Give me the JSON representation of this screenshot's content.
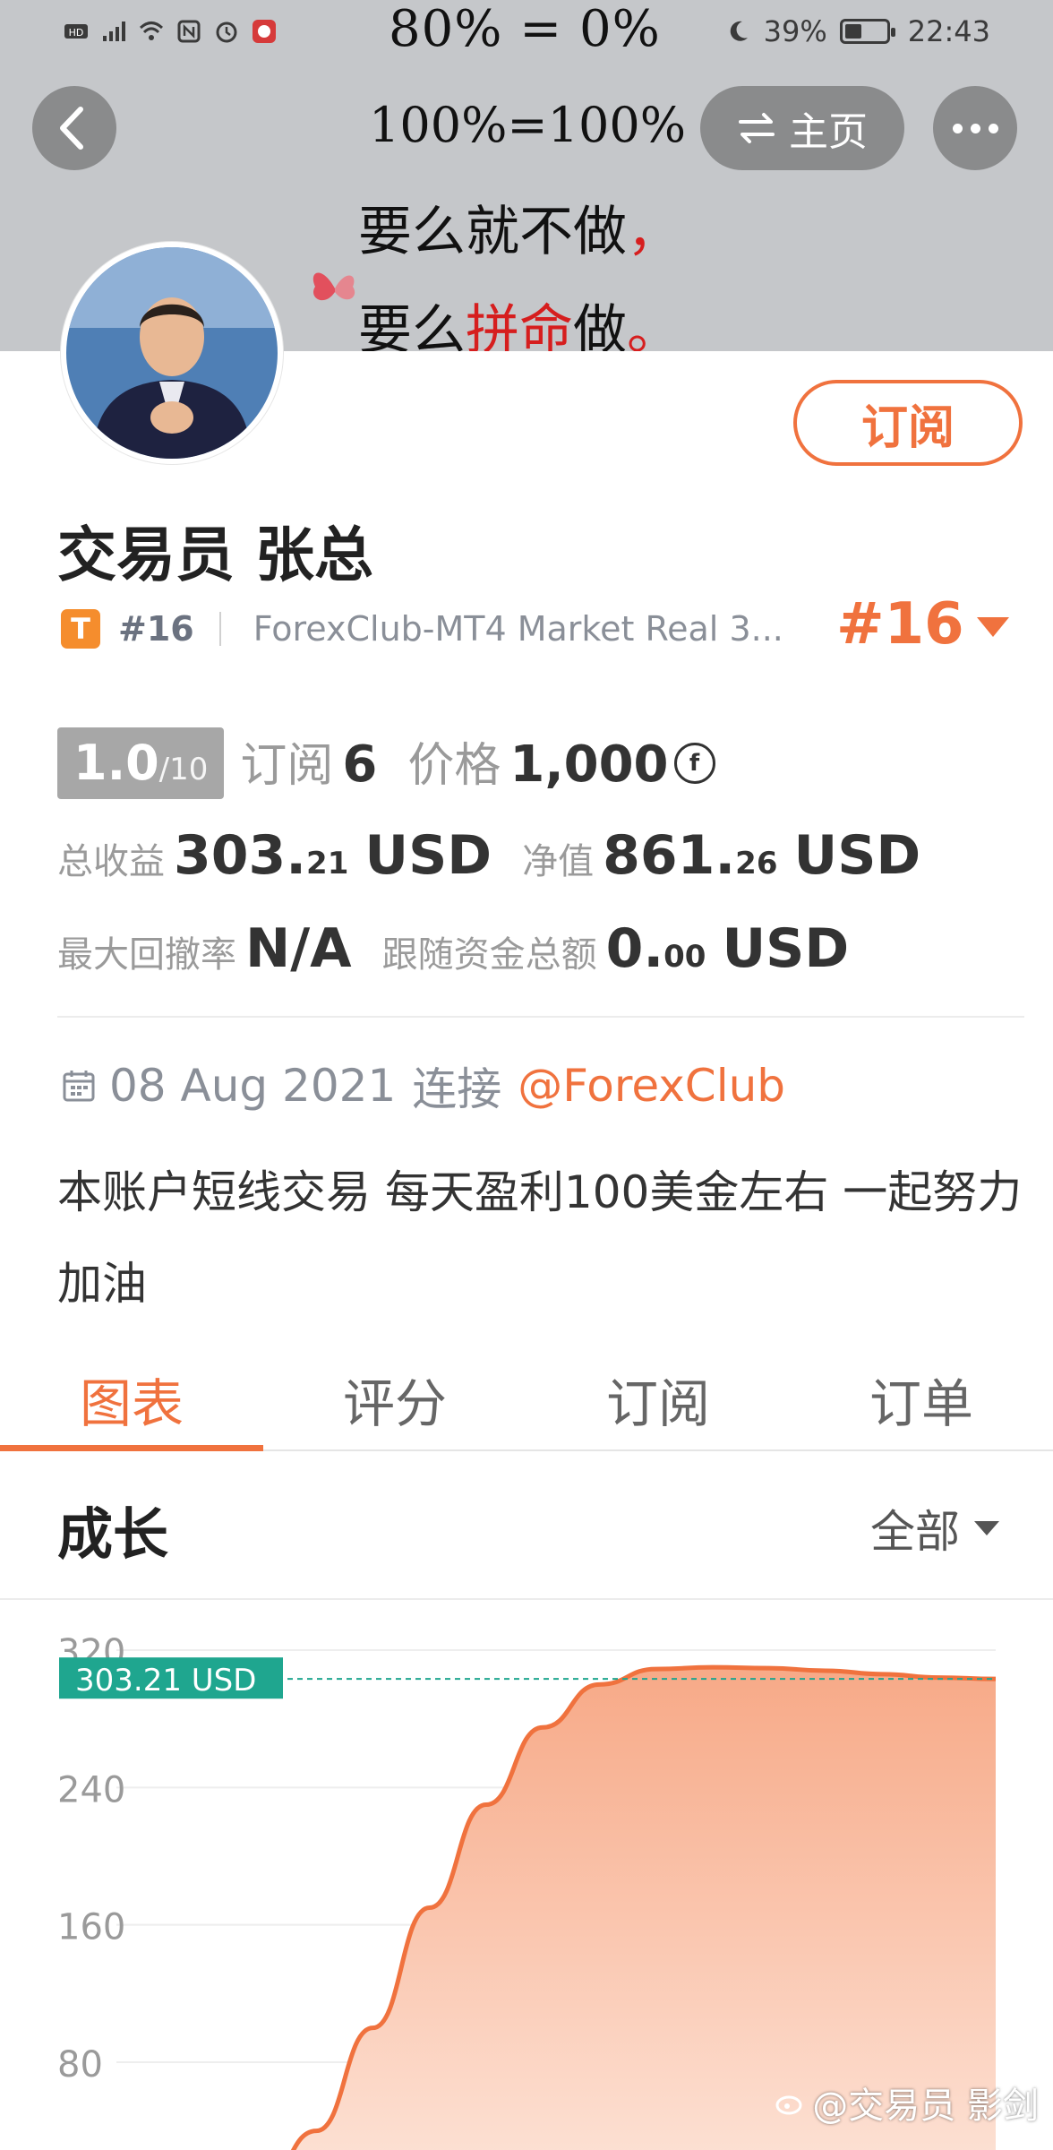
{
  "status_bar": {
    "battery_percent": "39%",
    "time": "22:43"
  },
  "banner": {
    "line1": "80% = 0%",
    "line2": "100%=100%",
    "line3_part1": "要么就不做",
    "line3_part2": "，",
    "line4_part1": "要么",
    "line4_part2": "拼命",
    "line4_part3": "做",
    "line4_part4": "。"
  },
  "nav": {
    "home_label": "主页"
  },
  "profile": {
    "subscribe_label": "订阅",
    "trader_name": "交易员  张总",
    "tag_letter": "T",
    "rank_small": "#16",
    "account": "ForexClub-MT4 Market Real 3...",
    "rank_big": "#16"
  },
  "stats": {
    "score": "1.0",
    "score_denominator": "/10",
    "subscribers_label": "订阅",
    "subscribers_value": "6",
    "price_label": "价格",
    "price_value": "1,000",
    "price_coin_symbol": "f",
    "total_profit_label": "总收益",
    "total_profit_int": "303.",
    "total_profit_dec": "21",
    "total_profit_unit": "USD",
    "equity_label": "净值",
    "equity_int": "861.",
    "equity_dec": "26",
    "equity_unit": "USD",
    "max_drawdown_label": "最大回撤率",
    "max_drawdown_value": "N/A",
    "follow_funds_label": "跟随资金总额",
    "follow_funds_int": "0.",
    "follow_funds_dec": "00",
    "follow_funds_unit": "USD"
  },
  "info": {
    "date": "08 Aug 2021",
    "connect_label": "连接",
    "broker_link": "@ForexClub",
    "description": "本账户短线交易 每天盈利100美金左右 一起努力加油"
  },
  "tabs": [
    {
      "label": "图表"
    },
    {
      "label": "评分"
    },
    {
      "label": "订阅"
    },
    {
      "label": "订单"
    }
  ],
  "section": {
    "title": "成长",
    "filter_label": "全部"
  },
  "chart_data": {
    "type": "area",
    "title": "成长",
    "xlabel": "",
    "ylabel": "",
    "ylim": [
      40,
      330
    ],
    "yticks": [
      "320",
      "240",
      "160",
      "80"
    ],
    "current_label": "303.21 USD",
    "current_value": 303.21,
    "series": [
      {
        "values": [
          5,
          40,
          100,
          170,
          230,
          275,
          300,
          309,
          310,
          309.5,
          308,
          306,
          304,
          303.21
        ]
      }
    ],
    "grid": true,
    "colors": {
      "line": "#f0723e",
      "fill_top": "#f7a987",
      "fill_bottom": "#fde4d8",
      "current_tag": "#1fa68f"
    }
  },
  "watermark": "@交易员 影剑"
}
